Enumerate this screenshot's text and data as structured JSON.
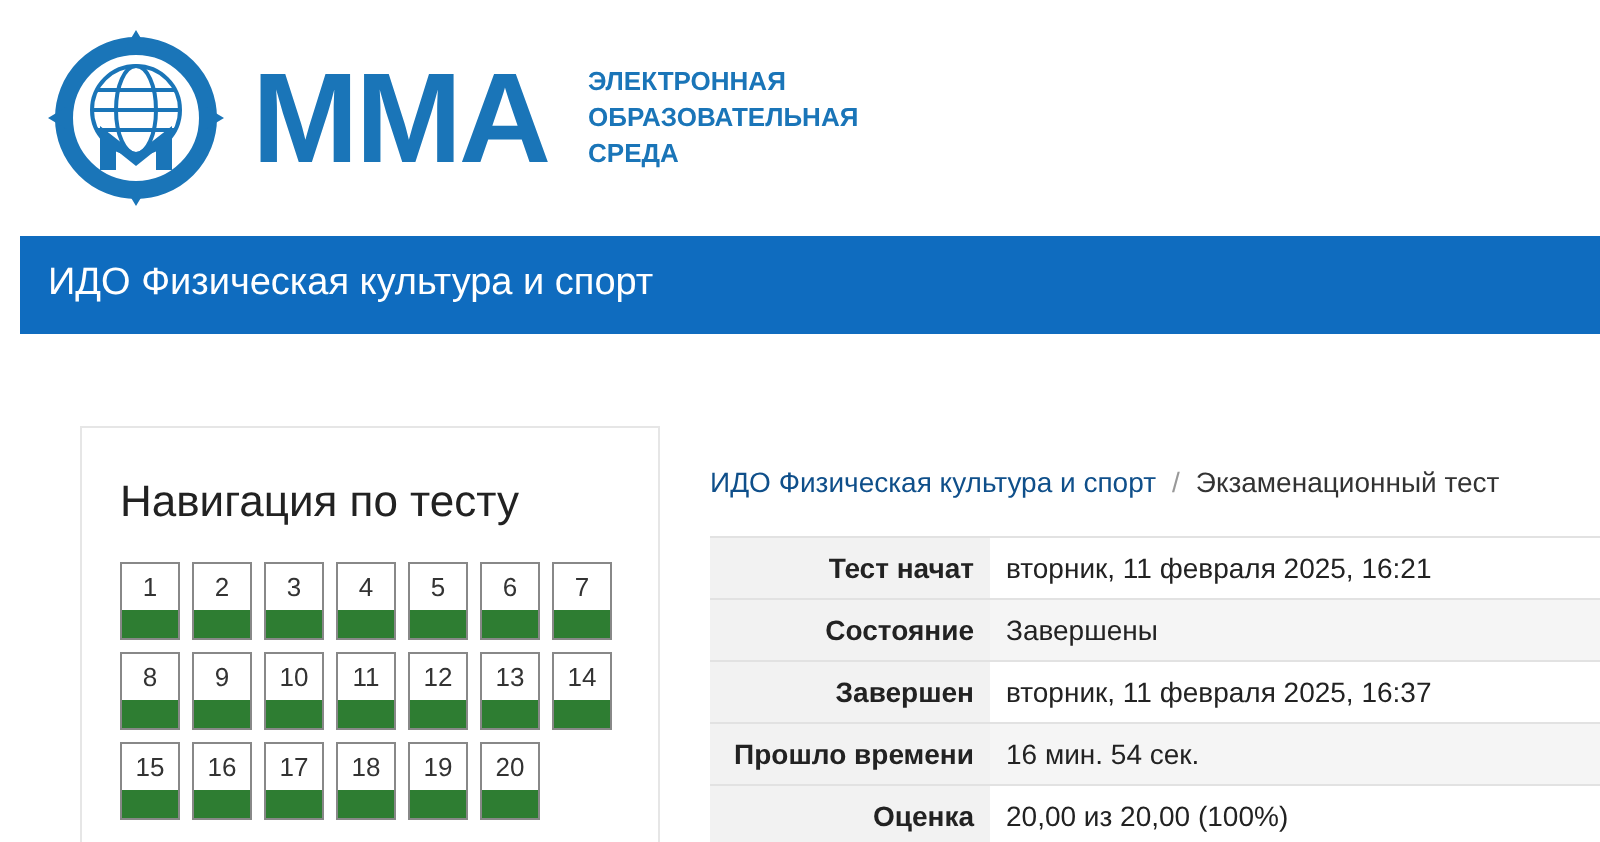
{
  "logo": {
    "mark": "ММА",
    "subtitle": [
      "ЭЛЕКТРОННАЯ",
      "ОБРАЗОВАТЕЛЬНАЯ",
      "СРЕДА"
    ]
  },
  "banner": {
    "title": "ИДО Физическая культура и спорт"
  },
  "navigation": {
    "title": "Навигация по тесту",
    "questions": [
      {
        "label": "1",
        "correct": true
      },
      {
        "label": "2",
        "correct": true
      },
      {
        "label": "3",
        "correct": true
      },
      {
        "label": "4",
        "correct": true
      },
      {
        "label": "5",
        "correct": true
      },
      {
        "label": "6",
        "correct": true
      },
      {
        "label": "7",
        "correct": true
      },
      {
        "label": "8",
        "correct": true
      },
      {
        "label": "9",
        "correct": true
      },
      {
        "label": "10",
        "correct": true
      },
      {
        "label": "11",
        "correct": true
      },
      {
        "label": "12",
        "correct": true
      },
      {
        "label": "13",
        "correct": true
      },
      {
        "label": "14",
        "correct": true
      },
      {
        "label": "15",
        "correct": true
      },
      {
        "label": "16",
        "correct": true
      },
      {
        "label": "17",
        "correct": true
      },
      {
        "label": "18",
        "correct": true
      },
      {
        "label": "19",
        "correct": true
      },
      {
        "label": "20",
        "correct": true
      }
    ]
  },
  "breadcrumb": {
    "link": "ИДО Физическая культура и спорт",
    "separator": "/",
    "current": "Экзаменационный тест"
  },
  "summary": [
    {
      "label": "Тест начат",
      "value": "вторник, 11 февраля 2025, 16:21"
    },
    {
      "label": "Состояние",
      "value": "Завершены"
    },
    {
      "label": "Завершен",
      "value": "вторник, 11 февраля 2025, 16:37"
    },
    {
      "label": "Прошло времени",
      "value": "16 мин. 54 сек."
    },
    {
      "label": "Оценка",
      "value": "20,00 из 20,00 (100%)"
    }
  ]
}
